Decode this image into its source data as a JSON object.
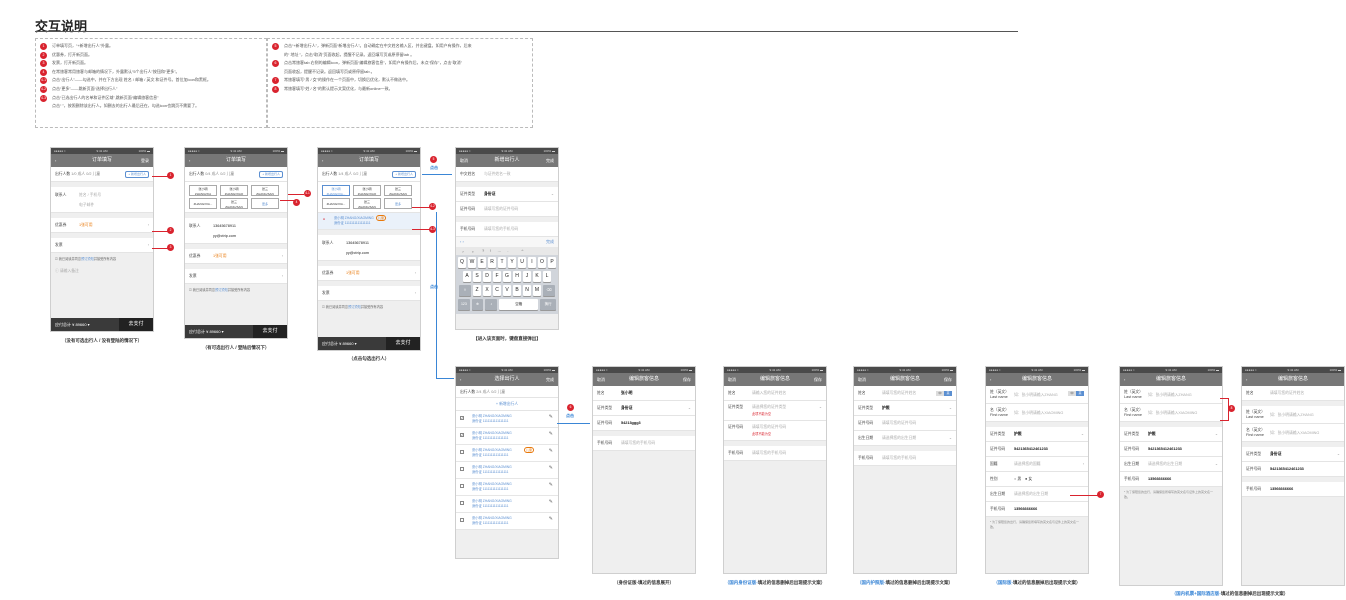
{
  "page": {
    "title": "交互说明"
  },
  "notes": {
    "left": [
      {
        "n": "1",
        "t": "订单填写页，“+新增出行人”外露。"
      },
      {
        "n": "2",
        "t": "优惠券，打开新页面。"
      },
      {
        "n": "3",
        "t": "发票，打开新页面。"
      },
      {
        "n": "4",
        "t": "在常旅客常用旅客与邮箱的情况下，外露默认“5个出行人”按钮和“更多”。"
      },
      {
        "n": "4-1",
        "t": "点击“出行人”——勾选中，并在下方出现 姓名 / 邮箱 / 英文 和证件号。首位加icon和黑框。"
      },
      {
        "n": "4-2",
        "t": "点击“更多”——跳新页面“选择出行人”"
      },
      {
        "n": "4-3",
        "t": "点击“已选出行人的名单和证件区域”,跳新页面“编辑旅客信息”"
      },
      {
        "n": "",
        "t": "点击“ ”，按照删除该出行人。如删去的出行人最后还在，勾选icon也跳页不需要了。"
      }
    ],
    "right": [
      {
        "n": "5",
        "t": "点击“+新增出行人”，弹新页面“新增出行人”。自动确定在中文姓名输入区，并出键盘。如用户有操作，后来"
      },
      {
        "n": "",
        "t": "的“ 地址 ”，点击“取消”页面收起，提醒不记录。返回填写页或原停留tab 。"
      },
      {
        "n": "6",
        "t": "点击常旅客tab 右侧的编辑icon，弹新页面“编辑旅客信息”，如用户有操作后，未点“保存”，点击“取消”"
      },
      {
        "n": "",
        "t": "页面收起，提醒不记录。返回填写页或原停留tab 。"
      },
      {
        "n": "7",
        "t": "常旅客填写“男 / 女”的操作在一个页面中，切换后优化，默认不做选中。"
      },
      {
        "n": "8",
        "t": "常旅客填写“姓 / 名”的默认提示文案优化，与最新online一致。"
      }
    ]
  },
  "status": {
    "carrier": "●●●●● ≈",
    "time": "9:41 AM",
    "battery": "100% ▬"
  },
  "screens": {
    "s1": {
      "nav": {
        "back": "‹",
        "title": "订单填写",
        "right": "登录"
      },
      "travelers_label": "出行人数",
      "travelers_info": "1/0  成人  0/2 儿童",
      "add_btn": "+ 新增出行人",
      "contact": "联系人",
      "contact_ph1": "姓名 / 手机号",
      "contact_ph2": "电子邮件",
      "coupon": "优惠券",
      "coupon_val": "1张可用",
      "invoice": "发票",
      "agree_pre": "我已阅读并同意",
      "agree_link": "预订须知",
      "agree_post": "并接受所有内容",
      "remark_ph": "请输入备注",
      "total": "应付总计 ¥ 89660  ▾",
      "pay": "去支付",
      "caption": "（没有可选出行人 / 没有登陆的情况下）"
    },
    "s2": {
      "nav": {
        "back": "‹",
        "title": "订单填写",
        "right": ""
      },
      "travelers_label": "出行人数",
      "travelers_info": "0/4  成人  0/2 儿童",
      "add_btn": "+ 新增出行人",
      "chips": [
        {
          "a": "张小明",
          "b": "ZHANG/XIA"
        },
        {
          "a": "张小明",
          "b": "ZHANG/XIAO"
        },
        {
          "a": "张三",
          "b": "ZHANG/SAN"
        },
        {
          "a": "ZHANG/XIA...",
          "b": ""
        },
        {
          "a": "张三",
          "b": "ZHANG/SAN"
        },
        {
          "a": "更多",
          "b": ""
        }
      ],
      "contact": "联系人",
      "phone": "13645678911",
      "email": "yy@ctrip.com",
      "coupon": "优惠券",
      "coupon_val": "1张可用",
      "invoice": "发票",
      "agree_pre": "我已阅读并同意",
      "agree_link": "预订须知",
      "agree_post": "并接受所有内容",
      "total": "应付总计 ¥ 89660  ▾",
      "pay": "去支付",
      "caption": "（有可选出行人 / 登陆后情况下）"
    },
    "s3": {
      "nav": {
        "back": "‹",
        "title": "订单填写",
        "right": ""
      },
      "travelers_label": "出行人数",
      "travelers_info": "1/4  成人  0/2 儿童",
      "add_btn": "+ 新增出行人",
      "chips": [
        {
          "a": "张小明",
          "b": "ZHANG/XIA..."
        },
        {
          "a": "张小明",
          "b": "ZHANG/XIAO"
        },
        {
          "a": "张三",
          "b": "ZHANG/SAN"
        },
        {
          "a": "ZHANG/XIA...",
          "b": ""
        },
        {
          "a": "张三",
          "b": "ZHANG/SAN"
        },
        {
          "a": "更多",
          "b": ""
        }
      ],
      "selected_name": "张小明  ZHANG/XIAOMING",
      "selected_tag": "儿童",
      "selected_id": "身份证  1111111111111111",
      "contact": "联系人",
      "phone": "13645678911",
      "email": "yy@ctrip.com",
      "coupon": "优惠券",
      "coupon_val": "1张可用",
      "invoice": "发票",
      "agree_pre": "我已阅读并同意",
      "agree_link": "预订须知",
      "agree_post": "并接受所有内容",
      "total": "应付总计 ¥ 89660  ▾",
      "pay": "去支付",
      "caption": "（点击勾选出行人）"
    },
    "s4": {
      "nav": {
        "back": "取消",
        "title": "新增出行人",
        "right": "完成"
      },
      "name": "中文姓名",
      "name_ph": "与证件姓名一致",
      "idtype": "证件类型",
      "idtype_val": "身份证",
      "idno": "证件号码",
      "idno_ph": "请填写您的证件号码",
      "phone": "手机号码",
      "phone_ph": "请填写您的手机号码",
      "kb_done": "完成",
      "kb_rows": [
        [
          "Q",
          "W",
          "E",
          "R",
          "T",
          "Y",
          "U",
          "I",
          "O",
          "P"
        ],
        [
          "A",
          "S",
          "D",
          "F",
          "G",
          "H",
          "J",
          "K",
          "L"
        ],
        [
          "Z",
          "X",
          "C",
          "V",
          "B",
          "N",
          "M"
        ]
      ],
      "kb_num": "123",
      "kb_space": "空格",
      "kb_go": "换行",
      "caption": "【进入该页面时，键盘直接弹出】"
    },
    "s5": {
      "nav": {
        "back": "‹",
        "title": "选择出行人",
        "right": "完成"
      },
      "travelers_label": "出行人数",
      "travelers_info": "2/4  成人    0/2  儿童",
      "add_btn": "+ 新增出行人",
      "list": [
        {
          "name": "张小明  ZHANG/XIAOMING",
          "id": "身份证 1111111111111111",
          "checked": "✓",
          "tag": ""
        },
        {
          "name": "张小明  ZHANG/XIAOMING",
          "id": "身份证 1111111111111111",
          "checked": "✓",
          "tag": ""
        },
        {
          "name": "张小明  ZHANG/XIAOMING",
          "id": "身份证 1111111111111111",
          "checked": "",
          "tag": "儿童"
        },
        {
          "name": "张小明  ZHANG/XIAOMING",
          "id": "身份证 1111111111111111",
          "checked": "",
          "tag": ""
        },
        {
          "name": "张小明  ZHANG/XIAOMING",
          "id": "身份证 1111111111111111",
          "checked": "",
          "tag": ""
        },
        {
          "name": "张小明  ZHANG/XIAOMING",
          "id": "身份证 1111111111111111",
          "checked": "",
          "tag": ""
        },
        {
          "name": "张小明  ZHANG/XIAOMING",
          "id": "身份证 1111111111111111",
          "checked": "",
          "tag": ""
        }
      ]
    },
    "s6": {
      "nav": {
        "back": "取消",
        "title": "编辑旅客信息",
        "right": "保存"
      },
      "name": "姓名",
      "name_val": "张小明",
      "idtype": "证件类型",
      "idtype_val": "身份证",
      "idno": "证件号码",
      "idno_val": "54213ggg3",
      "phone": "手机号码",
      "phone_ph": "请填写您的手机号码",
      "caption": "（身份证版-填过的信息展开）"
    },
    "s7": {
      "nav": {
        "back": "取消",
        "title": "编辑旅客信息",
        "right": "保存"
      },
      "name": "姓名",
      "name_ph": "请输入您的证件姓名",
      "idtype": "证件类型",
      "idtype_ph": "请选择您的证件类型",
      "err1": "此项不能为空",
      "idno": "证件号码",
      "idno_ph": "请填写您的证件号码",
      "err2": "此项不能为空",
      "phone": "手机号码",
      "phone_ph": "请填写您的手机号码",
      "caption_blue": "（国内身份证版-",
      "caption_rest": "填过的信息删掉后出现提示文案）"
    },
    "s8": {
      "nav": {
        "back": "取消",
        "title": "编辑旅客信息",
        "right": "保存"
      },
      "name": "姓名",
      "name_ph": "请填写您的证件姓名",
      "toggle": [
        "中",
        "英"
      ],
      "idtype": "证件类型",
      "idtype_val": "护照",
      "idno": "证件号码",
      "idno_ph": "请填写您的证件号码",
      "expire": "出生日期",
      "expire_ph": "请选择您的出生日期",
      "phone": "手机号码",
      "phone_ph": "请填写您的手机号码",
      "caption_blue": "（国内护照版-",
      "caption_rest": "填过的信息删掉后出现提示文案）"
    },
    "s9": {
      "nav": {
        "back": "‹",
        "title": "编辑旅客信息",
        "right": ""
      },
      "last": "姓（英文）",
      "last_en": "Last name",
      "last_ph": "如：张小明请输入ZHANG",
      "toggle": [
        "中",
        "英"
      ],
      "first": "名（英文）",
      "first_en": "First name",
      "first_ph": "如：张小明请输入XIAOMING",
      "idtype": "证件类型",
      "idtype_val": "护照",
      "idno": "证件号码",
      "idno_val": "5421365412461233",
      "nation": "国籍",
      "nation_ph": "请选择您的国籍",
      "gender": "性别",
      "male": "男",
      "female": "女",
      "birth": "出生日期",
      "birth_ph": "请选择您的出生日期",
      "phone": "手机号码",
      "phone_val": "13566666666",
      "hint": "* 为了保障您的出行，请确保您所填写的英文名与证件上的英文名一致。",
      "caption_blue": "（国际版-",
      "caption_rest": "填过的信息删掉后出现提示文案）"
    },
    "s10": {
      "nav": {
        "back": "‹",
        "title": "编辑旅客信息",
        "right": ""
      },
      "last": "姓（英文）",
      "last_en": "Last name",
      "last_ph": "如：张小明请输入ZHANG",
      "first": "名（英文）",
      "first_en": "First name",
      "first_ph": "如：张小明请输入XIAOMING",
      "idtype": "证件类型",
      "idtype_val": "护照",
      "idno": "证件号码",
      "idno_val": "5421365412461233",
      "birth": "出生日期",
      "birth_ph": "请选择您的出生日期",
      "phone": "手机号码",
      "phone_val": "13566666666",
      "hint": "* 为了保障您的出行，请确保您所填写的英文名与证件上的英文名一致。"
    },
    "s11": {
      "nav": {
        "back": "‹",
        "title": "编辑旅客信息",
        "right": ""
      },
      "name": "姓名",
      "name_ph": "请填写您的证件姓名",
      "last": "姓（英文）",
      "last_en": "Last name",
      "last_ph": "如：张小明请输入ZHANG",
      "first": "名（英文）",
      "first_en": "First name",
      "first_ph": "如：张小明请输入XIAOMING",
      "idtype": "证件类型",
      "idtype_val": "身份证",
      "idno": "证件号码",
      "idno_val": "5421365412461233",
      "phone": "手机号码",
      "phone_val": "13566666666",
      "caption_blue": "（国内机票+国际酒店版-",
      "caption_rest": "填过的信息删掉后出现提示文案）"
    }
  },
  "annotations": {
    "click": "点击",
    "b1": "1",
    "b2": "2",
    "b3": "3",
    "b4": "4",
    "b41": "4-1",
    "b42": "4-2",
    "b43": "4-3",
    "b5": "5",
    "b6": "6",
    "b7": "7",
    "b8": "8"
  },
  "colors": {
    "accent": "#3a86d6",
    "badge": "#d9232e",
    "orange": "#e8780a"
  }
}
